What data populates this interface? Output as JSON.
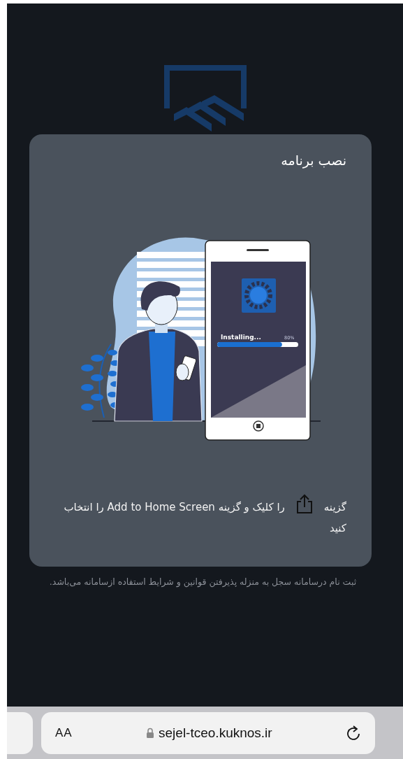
{
  "dialog": {
    "title": "نصب برنامه",
    "illustration": {
      "status": "Installing...",
      "percent": "80%",
      "level": 0.8
    },
    "instruction_before": "گزینه",
    "instruction_after": "را کلیک و گزینه Add to Home Screen را انتخاب",
    "instruction_end": "کنید"
  },
  "terms": "ثبت نام درسامانه سجل به منزله پذیرفتن قوانین و شرایط استفاده ازسامانه می‌باشد.",
  "browser_bar": {
    "text_size": "AA",
    "url": "sejel-tceo.kuknos.ir"
  }
}
